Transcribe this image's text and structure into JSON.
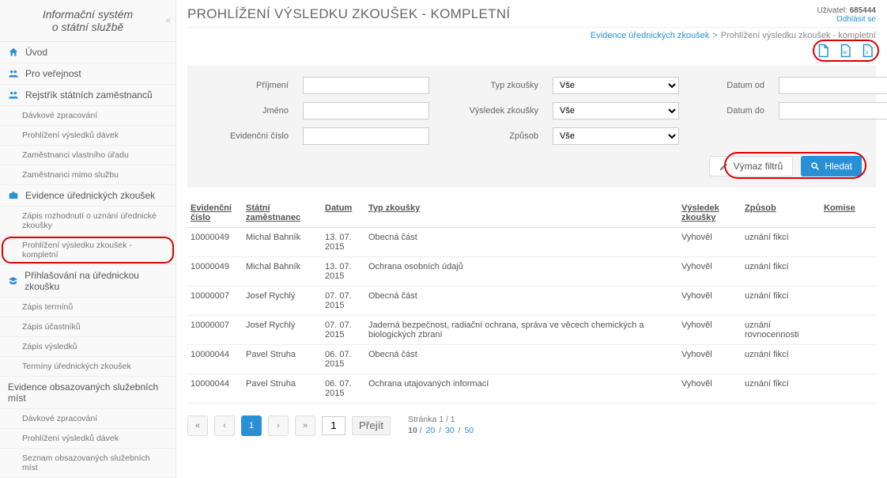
{
  "app": {
    "title_line1": "Informační systém",
    "title_line2": "o státní službě"
  },
  "user": {
    "label": "Uživatel:",
    "id": "685444",
    "logout": "Odhlásit se"
  },
  "page_title": "PROHLÍŽENÍ VÝSLEDKU ZKOUŠEK - KOMPLETNÍ",
  "breadcrumb": {
    "root": "Evidence úřednických zkoušek",
    "separator": ">",
    "current": "Prohlížení výsledku zkoušek - kompletní"
  },
  "nav": {
    "uvod": "Úvod",
    "verejnost": "Pro veřejnost",
    "rejstrik": "Rejstřík státních zaměstnanců",
    "rejstrik_sub": [
      "Dávkové zpracování",
      "Prohlížení výsledků dávek",
      "Zaměstnanci vlastního úřadu",
      "Zaměstnanci mimo službu"
    ],
    "evidence": "Evidence úřednických zkoušek",
    "evidence_sub": [
      "Zápis rozhodnutí o uznání úřednické zkoušky",
      "Prohlížení výsledku zkoušek - kompletní"
    ],
    "prihlasovani": "Přihlašování na úřednickou zkoušku",
    "prihlasovani_sub": [
      "Zápis termínů",
      "Zápis účastníků",
      "Zápis výsledků",
      "Termíny úřednických zkoušek"
    ],
    "mista": "Evidence obsazovaných služebních míst",
    "mista_sub": [
      "Dávkové zpracování",
      "Prohlížení výsledků dávek",
      "Seznam obsazovaných služebních míst"
    ]
  },
  "filters": {
    "prijmeni": {
      "label": "Příjmení",
      "value": ""
    },
    "jmeno": {
      "label": "Jméno",
      "value": ""
    },
    "ev_cislo": {
      "label": "Evidenční číslo",
      "value": ""
    },
    "typ": {
      "label": "Typ zkoušky",
      "value": "Vše"
    },
    "vysledek": {
      "label": "Výsledek zkoušky",
      "value": "Vše"
    },
    "zpusob": {
      "label": "Způsob",
      "value": "Vše"
    },
    "datum_od": {
      "label": "Datum od",
      "value": ""
    },
    "datum_do": {
      "label": "Datum do",
      "value": ""
    },
    "clear": "Výmaz filtrů",
    "search": "Hledat"
  },
  "export": {
    "pdf": "PDF",
    "doc": "DOC",
    "xls": "XLS"
  },
  "table": {
    "headers": {
      "ev": "Evidenční číslo",
      "zam": "Státní zaměstnanec",
      "datum": "Datum",
      "typ": "Typ zkoušky",
      "vysl": "Výsledek zkoušky",
      "zpusob": "Způsob",
      "komise": "Komise"
    },
    "rows": [
      {
        "ev": "10000049",
        "zam": "Michal Bahník",
        "datum": "13. 07. 2015",
        "typ": "Obecná část",
        "vysl": "Vyhověl",
        "zpusob": "uznání fikcí",
        "komise": ""
      },
      {
        "ev": "10000049",
        "zam": "Michal Bahník",
        "datum": "13. 07. 2015",
        "typ": "Ochrana osobních údajů",
        "vysl": "Vyhověl",
        "zpusob": "uznání fikcí",
        "komise": ""
      },
      {
        "ev": "10000007",
        "zam": "Josef Rychlý",
        "datum": "07. 07. 2015",
        "typ": "Obecná část",
        "vysl": "Vyhověl",
        "zpusob": "uznání fikcí",
        "komise": ""
      },
      {
        "ev": "10000007",
        "zam": "Josef Rychlý",
        "datum": "07. 07. 2015",
        "typ": "Jaderná bezpečnost, radiační ochrana, správa ve věcech chemických a biologických zbraní",
        "vysl": "Vyhověl",
        "zpusob": "uznání rovnocennosti",
        "komise": ""
      },
      {
        "ev": "10000044",
        "zam": "Pavel Struha",
        "datum": "06. 07. 2015",
        "typ": "Obecná část",
        "vysl": "Vyhověl",
        "zpusob": "uznání fikcí",
        "komise": ""
      },
      {
        "ev": "10000044",
        "zam": "Pavel Struha",
        "datum": "06. 07. 2015",
        "typ": "Ochrana utajovaných informací",
        "vysl": "Vyhověl",
        "zpusob": "uznání fikcí",
        "komise": ""
      }
    ]
  },
  "pager": {
    "current": "1",
    "jump_value": "1",
    "go": "Přejít",
    "page_info": "Stránka 1 / 1",
    "page_size_current": "10",
    "page_sizes": [
      "20",
      "30",
      "50"
    ]
  }
}
